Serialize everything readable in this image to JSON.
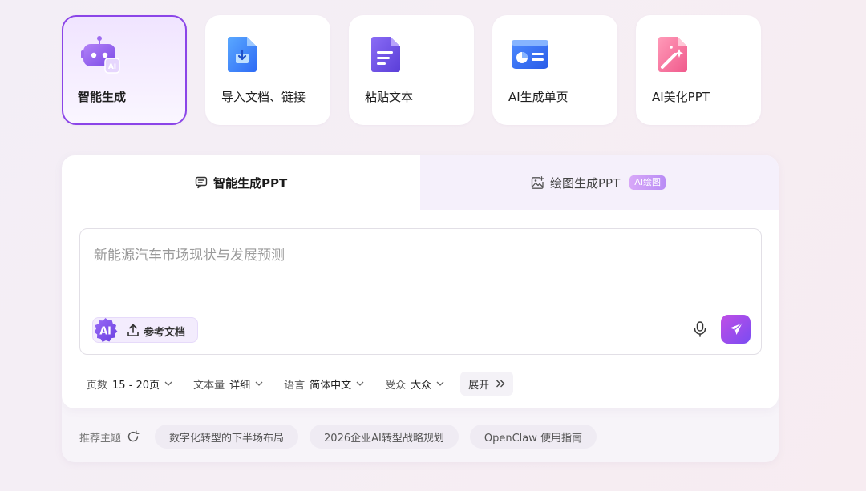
{
  "mode_cards": [
    {
      "label": "智能生成",
      "icon": "robot-icon",
      "active": true
    },
    {
      "label": "导入文档、链接",
      "icon": "import-document-icon",
      "active": false
    },
    {
      "label": "粘贴文本",
      "icon": "paste-text-icon",
      "active": false
    },
    {
      "label": "AI生成单页",
      "icon": "single-page-icon",
      "active": false
    },
    {
      "label": "AI美化PPT",
      "icon": "magic-beautify-icon",
      "active": false
    }
  ],
  "tabs": [
    {
      "label": "智能生成PPT",
      "icon": "chat-box-icon",
      "active": true
    },
    {
      "label": "绘图生成PPT",
      "icon": "image-plus-icon",
      "active": false,
      "tag": "AI绘图"
    }
  ],
  "prompt": {
    "placeholder": "新能源汽车市场现状与发展预测",
    "value": "",
    "ai_badge": "Ai",
    "reference_doc_label": "参考文档"
  },
  "options": [
    {
      "key": "页数",
      "value": "15 - 20页"
    },
    {
      "key": "文本量",
      "value": "详细"
    },
    {
      "key": "语言",
      "value": "简体中文"
    },
    {
      "key": "受众",
      "value": "大众"
    }
  ],
  "expand_label": "展开",
  "recommend": {
    "label": "推荐主题",
    "topics": [
      "数字化转型的下半场布局",
      "2026企业AI转型战略规划",
      "OpenClaw 使用指南"
    ]
  },
  "colors": {
    "accent": "#8b45e8",
    "send_gradient_start": "#c04ee6",
    "send_gradient_end": "#7a4cf2"
  }
}
